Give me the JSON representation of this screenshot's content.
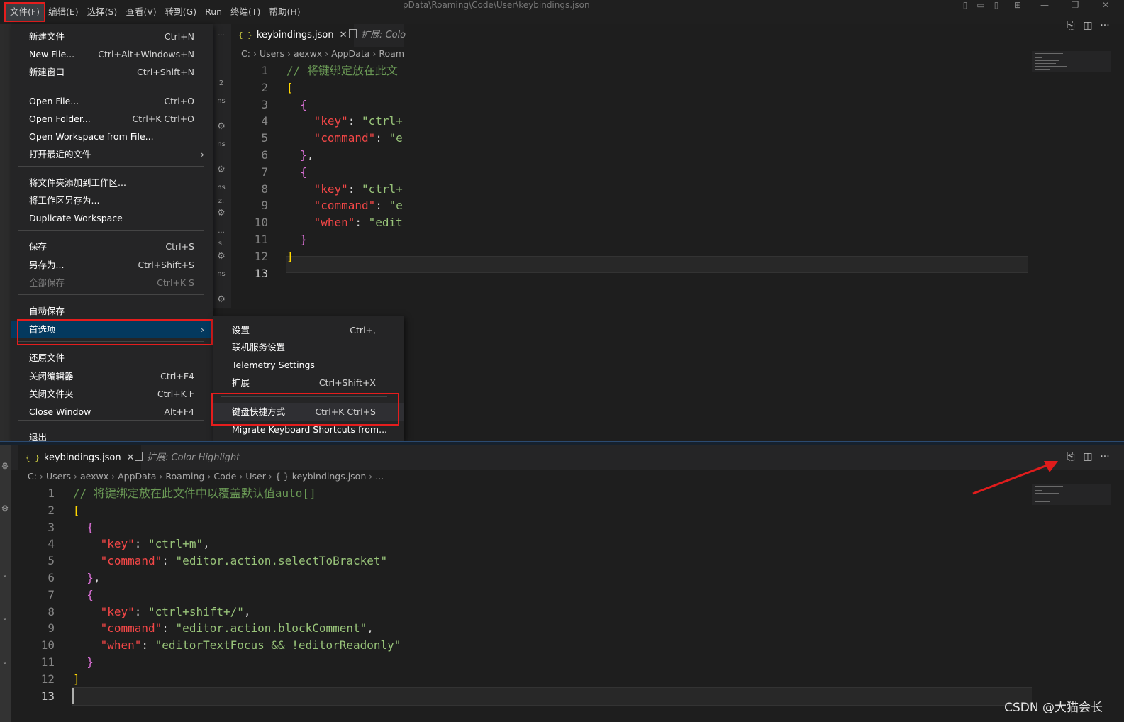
{
  "titlebar": {
    "path_fragment": "pData\\Roaming\\Code\\User\\keybindings.json"
  },
  "menubar": [
    {
      "label": "文件(F)",
      "highlighted": true
    },
    {
      "label": "编辑(E)"
    },
    {
      "label": "选择(S)"
    },
    {
      "label": "查看(V)"
    },
    {
      "label": "转到(G)"
    },
    {
      "label": "Run"
    },
    {
      "label": "终端(T)"
    },
    {
      "label": "帮助(H)"
    }
  ],
  "file_menu": {
    "items": [
      {
        "label": "新建文件",
        "shortcut": "Ctrl+N"
      },
      {
        "label": "New File...",
        "shortcut": "Ctrl+Alt+Windows+N"
      },
      {
        "label": "新建窗口",
        "shortcut": "Ctrl+Shift+N"
      },
      {
        "label": "Open File...",
        "shortcut": "Ctrl+O"
      },
      {
        "label": "Open Folder...",
        "shortcut": "Ctrl+K Ctrl+O"
      },
      {
        "label": "Open Workspace from File...",
        "shortcut": ""
      },
      {
        "label": "打开最近的文件",
        "shortcut": "",
        "submenu": true
      },
      {
        "label": "将文件夹添加到工作区...",
        "shortcut": ""
      },
      {
        "label": "将工作区另存为...",
        "shortcut": ""
      },
      {
        "label": "Duplicate Workspace",
        "shortcut": ""
      },
      {
        "label": "保存",
        "shortcut": "Ctrl+S"
      },
      {
        "label": "另存为...",
        "shortcut": "Ctrl+Shift+S"
      },
      {
        "label": "全部保存",
        "shortcut": "Ctrl+K S",
        "disabled": true
      },
      {
        "label": "自动保存",
        "shortcut": ""
      },
      {
        "label": "首选项",
        "shortcut": "",
        "submenu": true,
        "selected": true
      },
      {
        "label": "还原文件",
        "shortcut": ""
      },
      {
        "label": "关闭编辑器",
        "shortcut": "Ctrl+F4"
      },
      {
        "label": "关闭文件夹",
        "shortcut": "Ctrl+K F"
      },
      {
        "label": "Close Window",
        "shortcut": "Alt+F4"
      },
      {
        "label": "退出",
        "shortcut": ""
      }
    ],
    "submenu_arrow": "›"
  },
  "preferences_submenu": {
    "items": [
      {
        "label": "设置",
        "shortcut": "Ctrl+,"
      },
      {
        "label": "联机服务设置",
        "shortcut": ""
      },
      {
        "label": "Telemetry Settings",
        "shortcut": ""
      },
      {
        "label": "扩展",
        "shortcut": "Ctrl+Shift+X"
      },
      {
        "label": "键盘快捷方式",
        "shortcut": "Ctrl+K Ctrl+S",
        "highlighted": true
      },
      {
        "label": "Migrate Keyboard Shortcuts from...",
        "shortcut": ""
      }
    ]
  },
  "explorer_fragments": [
    "...",
    "2",
    "ns",
    "ns",
    "ns",
    "z.",
    "...",
    "s.",
    "ns"
  ],
  "top_editor": {
    "tabs": [
      {
        "icon": "{ }",
        "label": "keybindings.json",
        "active": true,
        "close": "✕"
      },
      {
        "label": "扩展: Colo",
        "active": false
      }
    ],
    "breadcrumbs": [
      "C:",
      "Users",
      "aexwx",
      "AppData",
      "Roamin"
    ],
    "lines": [
      {
        "n": "1",
        "code": "// 将键绑定放在此文"
      },
      {
        "n": "2",
        "code": "["
      },
      {
        "n": "3",
        "code": "  {"
      },
      {
        "n": "4",
        "code": "    \"key\": \"ctrl+"
      },
      {
        "n": "5",
        "code": "    \"command\": \"e"
      },
      {
        "n": "6",
        "code": "  },"
      },
      {
        "n": "7",
        "code": "  {"
      },
      {
        "n": "8",
        "code": "    \"key\": \"ctrl+"
      },
      {
        "n": "9",
        "code": "    \"command\": \"e,"
      },
      {
        "n": "10",
        "code": "    \"when\": \"edit"
      },
      {
        "n": "11",
        "code": "  }"
      },
      {
        "n": "12",
        "code": "]"
      },
      {
        "n": "13",
        "code": ""
      }
    ]
  },
  "bottom_editor": {
    "tabs": [
      {
        "icon": "{ }",
        "label": "keybindings.json",
        "active": true,
        "close": "✕"
      },
      {
        "label": "扩展: Color Highlight",
        "active": false
      }
    ],
    "breadcrumbs": [
      "C:",
      "Users",
      "aexwx",
      "AppData",
      "Roaming",
      "Code",
      "User",
      "{ } keybindings.json",
      "..."
    ],
    "lines": [
      {
        "n": "1",
        "code": "// 将键绑定放在此文件中以覆盖默认值auto[]"
      },
      {
        "n": "2",
        "code": "["
      },
      {
        "n": "3",
        "code": "  {"
      },
      {
        "n": "4",
        "code": "    \"key\": \"ctrl+m\","
      },
      {
        "n": "5",
        "code": "    \"command\": \"editor.action.selectToBracket\""
      },
      {
        "n": "6",
        "code": "  },"
      },
      {
        "n": "7",
        "code": "  {"
      },
      {
        "n": "8",
        "code": "    \"key\": \"ctrl+shift+/\","
      },
      {
        "n": "9",
        "code": "    \"command\": \"editor.action.blockComment\","
      },
      {
        "n": "10",
        "code": "    \"when\": \"editorTextFocus && !editorReadonly\""
      },
      {
        "n": "11",
        "code": "  }"
      },
      {
        "n": "12",
        "code": "]"
      },
      {
        "n": "13",
        "code": ""
      }
    ]
  },
  "editor_actions": {
    "open_json_icon": "⎘",
    "split_icon": "◫",
    "more_icon": "···"
  },
  "colors": {
    "highlight_border": "#e51d1d",
    "selected_item": "#04395e",
    "arrow": "#e01c1c"
  },
  "watermark": "CSDN @大猫会长"
}
